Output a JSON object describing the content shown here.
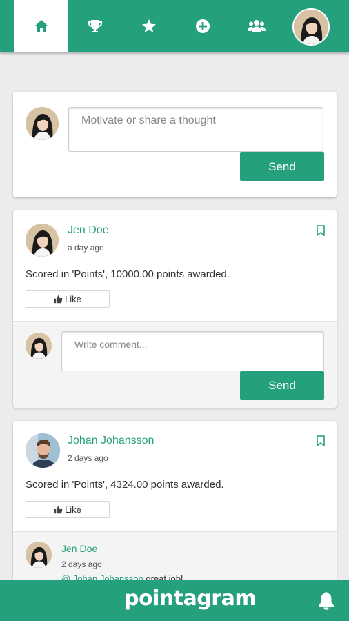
{
  "nav": {
    "tabs": [
      {
        "name": "home",
        "icon": "home-icon",
        "active": true
      },
      {
        "name": "trophy",
        "icon": "trophy-icon"
      },
      {
        "name": "star",
        "icon": "star-icon"
      },
      {
        "name": "add",
        "icon": "plus-circle-icon"
      },
      {
        "name": "people",
        "icon": "people-icon"
      }
    ],
    "accent_color": "#25a07c"
  },
  "compose": {
    "placeholder": "Motivate or share a thought",
    "send_label": "Send"
  },
  "posts": [
    {
      "author": "Jen Doe",
      "time": "a day ago",
      "text": "Scored in 'Points', 10000.00 points awarded.",
      "like_label": "Like",
      "comment_placeholder": "Write comment...",
      "send_label": "Send"
    },
    {
      "author": "Johan Johansson",
      "time": "2 days ago",
      "text": "Scored in 'Points', 4324.00 points awarded.",
      "like_label": "Like",
      "comments": [
        {
          "author": "Jen Doe",
          "time": "2 days ago",
          "mention": "@ Johan Johansson",
          "text": " great job!"
        }
      ]
    }
  ],
  "footer": {
    "logo": "pointagram"
  }
}
